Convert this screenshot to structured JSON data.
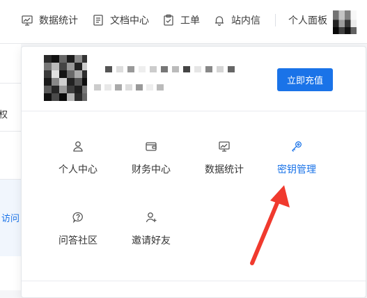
{
  "topnav": {
    "items": [
      {
        "label": "数据统计",
        "icon": "chart-icon"
      },
      {
        "label": "文档中心",
        "icon": "document-icon"
      },
      {
        "label": "工单",
        "icon": "ticket-icon"
      },
      {
        "label": "站内信",
        "icon": "bell-icon"
      }
    ],
    "personal_panel": "个人面板"
  },
  "background": {
    "left_text_1": "权",
    "left_text_2": "访问"
  },
  "dropdown": {
    "recharge_label": "立即充值",
    "menu": [
      {
        "label": "个人中心",
        "icon": "user-icon",
        "active": false
      },
      {
        "label": "财务中心",
        "icon": "wallet-icon",
        "active": false
      },
      {
        "label": "数据统计",
        "icon": "chart-icon",
        "active": false
      },
      {
        "label": "密钥管理",
        "icon": "key-icon",
        "active": true
      },
      {
        "label": "问答社区",
        "icon": "question-chat-icon",
        "active": false
      },
      {
        "label": "邀请好友",
        "icon": "add-user-icon",
        "active": false
      }
    ]
  },
  "colors": {
    "accent": "#1a73e8",
    "annotation_arrow": "#f03a2e"
  }
}
